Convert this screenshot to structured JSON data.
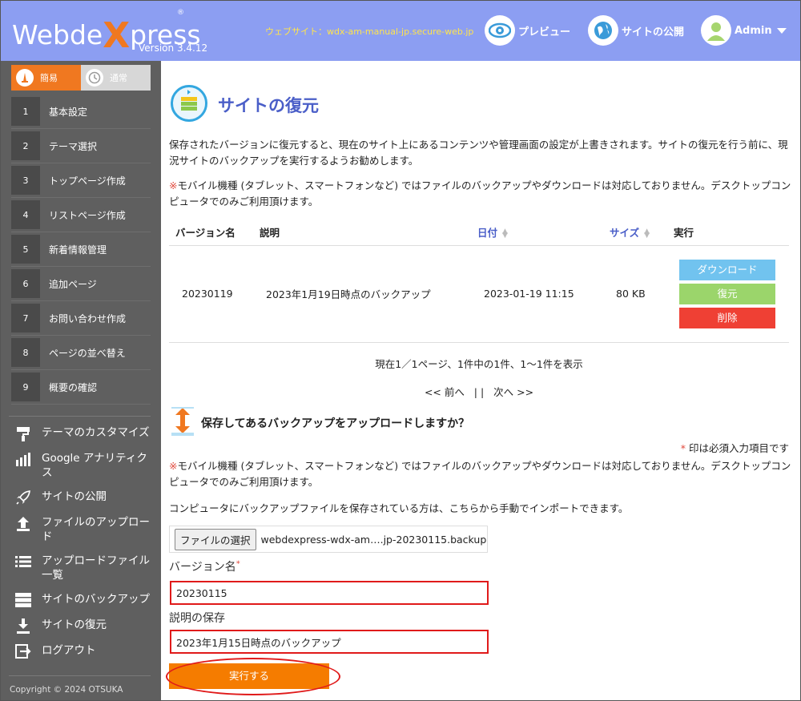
{
  "header": {
    "logo_prefix": "Webde",
    "logo_x": "X",
    "logo_suffix": "press",
    "logo_reg": "®",
    "version": "Version 3.4.12",
    "site_url": "ウェブサイト：wdx-am-manual-jp.secure-web.jp",
    "preview_label": "プレビュー",
    "publish_label": "サイトの公開",
    "admin_label": "Admin"
  },
  "sidebar": {
    "mode_easy": "簡易",
    "mode_normal": "通常",
    "steps": [
      {
        "num": "1",
        "label": "基本設定"
      },
      {
        "num": "2",
        "label": "テーマ選択"
      },
      {
        "num": "3",
        "label": "トップページ作成"
      },
      {
        "num": "4",
        "label": "リストページ作成"
      },
      {
        "num": "5",
        "label": "新着情報管理"
      },
      {
        "num": "6",
        "label": "追加ページ"
      },
      {
        "num": "7",
        "label": "お問い合わせ作成"
      },
      {
        "num": "8",
        "label": "ページの並べ替え"
      },
      {
        "num": "9",
        "label": "概要の確認"
      }
    ],
    "menu": [
      {
        "label": "テーマのカスタマイズ",
        "icon": "paint-roller-icon"
      },
      {
        "label": "Google アナリティクス",
        "icon": "bar-chart-icon"
      },
      {
        "label": "サイトの公開",
        "icon": "rocket-icon"
      },
      {
        "label": "ファイルのアップロード",
        "icon": "upload-icon"
      },
      {
        "label": "アップロードファイル一覧",
        "icon": "list-icon"
      },
      {
        "label": "サイトのバックアップ",
        "icon": "server-icon"
      },
      {
        "label": "サイトの復元",
        "icon": "download-icon"
      },
      {
        "label": "ログアウト",
        "icon": "logout-icon"
      }
    ],
    "copyright": "Copyright © 2024 OTSUKA"
  },
  "main": {
    "title": "サイトの復元",
    "intro": "保存されたバージョンに復元すると、現在のサイト上にあるコンテンツや管理画面の設定が上書きされます。サイトの復元を行う前に、現況サイトのバックアップを実行するようお勧めします。",
    "warn_mark": "※",
    "mobile_note": "モバイル機種 (タブレット、スマートフォンなど) ではファイルのバックアップやダウンロードは対応しておりません。デスクトップコンピュータでのみご利用頂けます。",
    "table": {
      "headers": {
        "version": "バージョン名",
        "description": "説明",
        "date": "日付",
        "size": "サイズ",
        "action": "実行"
      },
      "rows": [
        {
          "version": "20230119",
          "description": "2023年1月19日時点のバックアップ",
          "date": "2023-01-19 11:15",
          "size": "80 KB"
        }
      ],
      "actions": {
        "download": "ダウンロード",
        "restore": "復元",
        "delete": "削除"
      }
    },
    "paging_info": "現在1／1ページ、1件中の1件、1〜1件を表示",
    "paging_prev": "<< 前へ",
    "paging_sep": "| |",
    "paging_next": "次へ >>",
    "upload_title": "保存してあるバックアップをアップロードしますか？",
    "req_mark": "*",
    "req_note": " 印は必須入力項目です",
    "import_note": "コンピュータにバックアップファイルを保存されている方は、こちらから手動でインポートできます。",
    "file_button": "ファイルの選択",
    "file_name": "webdexpress-wdx-am….jp-20230115.backup",
    "version_label": "バージョン名",
    "version_value": "20230115",
    "desc_label": "説明の保存",
    "desc_value": "2023年1月15日時点のバックアップ",
    "submit_label": "実行する"
  },
  "colors": {
    "header_bg": "#8c9ef2",
    "sidebar_bg": "#5f5f5f",
    "accent_orange": "#f57c00",
    "title_blue": "#4a5ec8",
    "highlight_red": "#e01a1a"
  }
}
